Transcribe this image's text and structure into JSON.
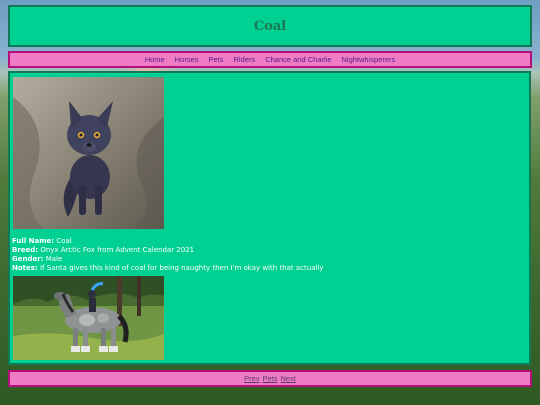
{
  "header": {
    "title": "Coal"
  },
  "nav": {
    "items": [
      "Home",
      "Horses",
      "Pets",
      "Riders",
      "Chance and Charlie",
      "Nightwhisperers"
    ]
  },
  "profile": {
    "full_name_label": "Full Name:",
    "full_name": "Coal",
    "breed_label": "Breed:",
    "breed": "Onyx Arctic Fox from Advent Calendar 2021",
    "gender_label": "Gender:",
    "gender": "Male",
    "notes_label": "Notes:",
    "notes": "If Santa gives this kind of coal for being naughty then I'm okay with that actually"
  },
  "footer": {
    "prev_label": "Prev",
    "pets_label": "Pets",
    "next_label": "Next"
  },
  "colors": {
    "panel_green": "#00d092",
    "panel_border_green": "#0b7a55",
    "nav_pink": "#ee7bc3",
    "nav_border_magenta": "#b4107c"
  }
}
